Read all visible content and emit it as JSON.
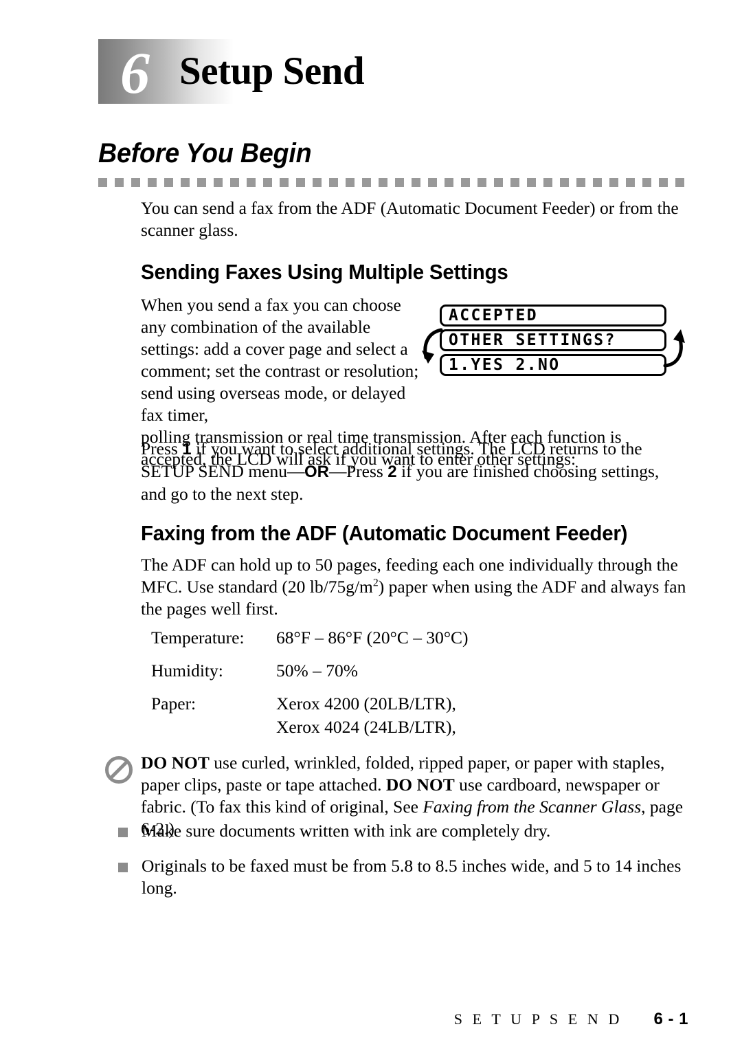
{
  "chapter": {
    "number": "6",
    "title": "Setup Send"
  },
  "section": {
    "heading": "Before You Begin",
    "intro": "You can send a fax from the ADF (Automatic Document Feeder) or from the scanner glass."
  },
  "multiple_settings": {
    "heading": "Sending Faxes Using Multiple Settings",
    "para_part1": "When you send a fax you can choose any combination of the available settings: add a cover page and select a comment; set the contrast or resolution; send using overseas mode, or delayed fax timer,",
    "para_part2": "polling transmission or real time transmission. After each function is accepted, the LCD will ask if you want to enter other settings:",
    "press_pre": "Press ",
    "press_key_1": "1",
    "press_mid1": " if you want to select additional settings. The LCD returns to the SETUP SEND menu",
    "press_dash1": "—",
    "press_or": "OR",
    "press_dash2": "—",
    "press_mid2": "Press ",
    "press_key_2": "2",
    "press_tail": " if you are finished choosing settings, and go to the next step."
  },
  "lcd": {
    "line1": "ACCEPTED",
    "line2": "OTHER SETTINGS?",
    "line3": "1.YES 2.NO",
    "arrow_left_icon": "curved-arrow-down-icon",
    "arrow_right_icon": "curved-arrow-up-icon"
  },
  "adf": {
    "heading": "Faxing from the ADF (Automatic Document Feeder)",
    "para_pre": "The ADF can hold up to 50 pages, feeding each one individually through the MFC. Use standard (20 lb/75g/m",
    "para_sup": "2",
    "para_post": ") paper when using the ADF and always fan the pages well first."
  },
  "specs": [
    {
      "label": "Temperature:",
      "value": "68°F – 86°F (20°C – 30°C)",
      "value2": ""
    },
    {
      "label": "Humidity:",
      "value": "50% – 70%",
      "value2": ""
    },
    {
      "label": "Paper:",
      "value": "Xerox 4200 (20LB/LTR),",
      "value2": "Xerox 4024 (24LB/LTR),"
    }
  ],
  "warning": {
    "icon": "prohibited-icon",
    "bold1": "DO NOT",
    "text1": " use curled, wrinkled, folded, ripped paper, or paper with staples, paper clips, paste or tape attached. ",
    "bold2": "DO NOT",
    "text2": " use cardboard, newspaper or fabric. (To fax this kind of original, See ",
    "italic_ref": "Faxing from the Scanner Glass",
    "text3": ", page 6-2.)"
  },
  "bullets": [
    "Make sure documents written with ink are completely dry.",
    "Originals to be faxed must be from 5.8 to 8.5 inches wide, and 5 to 14 inches long."
  ],
  "footer": {
    "chapter_name": "S E T U P  S E N D",
    "page_number": "6 - 1"
  },
  "colors": {
    "rule_gray": "#999999",
    "bullet_gray": "#8c8c8c",
    "icon_gray": "#8c8c8c",
    "band_dark": "#7a7a7a"
  }
}
